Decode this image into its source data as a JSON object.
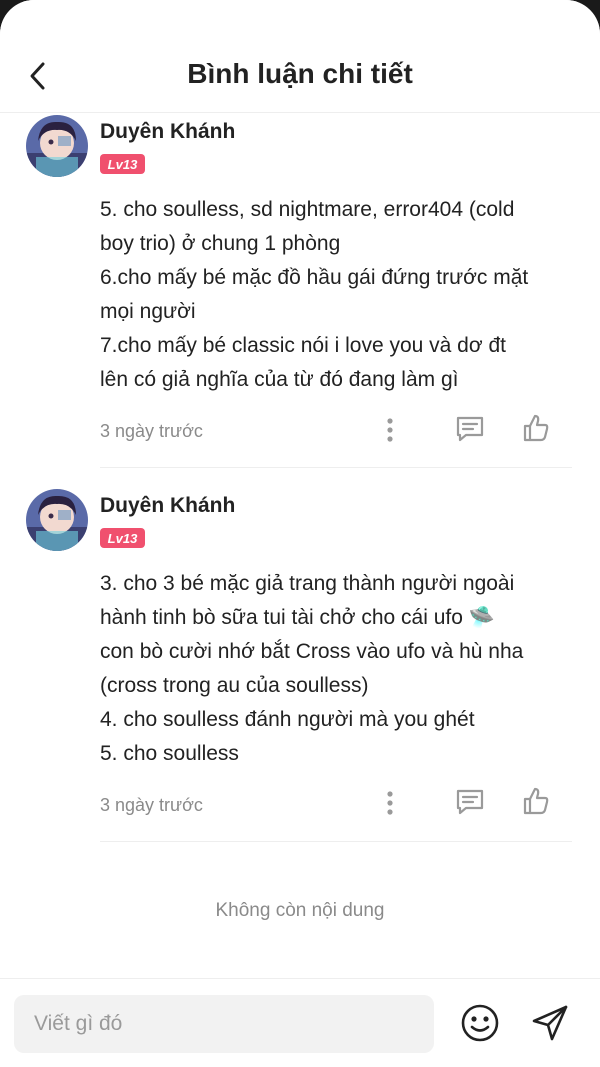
{
  "header": {
    "title": "Bình luận chi tiết",
    "back_icon": "chevron-left-icon"
  },
  "comments": [
    {
      "author": "Duyên Khánh",
      "level": "Lv13",
      "lines": [
        "5. cho soulless, sd nightmare, error404 (cold",
        "boy trio) ở chung 1 phòng",
        "6.cho mấy bé mặc đồ hầu gái đứng trước mặt",
        "mọi người",
        "7.cho mấy bé classic nói i love you và dơ đt",
        "lên có giả nghĩa của từ đó đang làm gì"
      ],
      "time": "3 ngày trước"
    },
    {
      "author": "Duyên Khánh",
      "level": "Lv13",
      "lines": [
        "3. cho 3 bé mặc giả trang thành người ngoài",
        "hành tinh bò sữa tui tài chở cho cái ufo 🛸",
        "con bò cười nhớ bắt Cross vào ufo và hù nha",
        "(cross trong au của soulless)",
        "4. cho soulless đánh người mà you ghét",
        "5. cho soulless"
      ],
      "time": "3 ngày trước"
    }
  ],
  "end_text": "Không còn nội dung",
  "footer": {
    "placeholder": "Viết gì đó"
  },
  "colors": {
    "badge": "#f0506e",
    "muted": "#8a8a8a",
    "text": "#222222"
  }
}
